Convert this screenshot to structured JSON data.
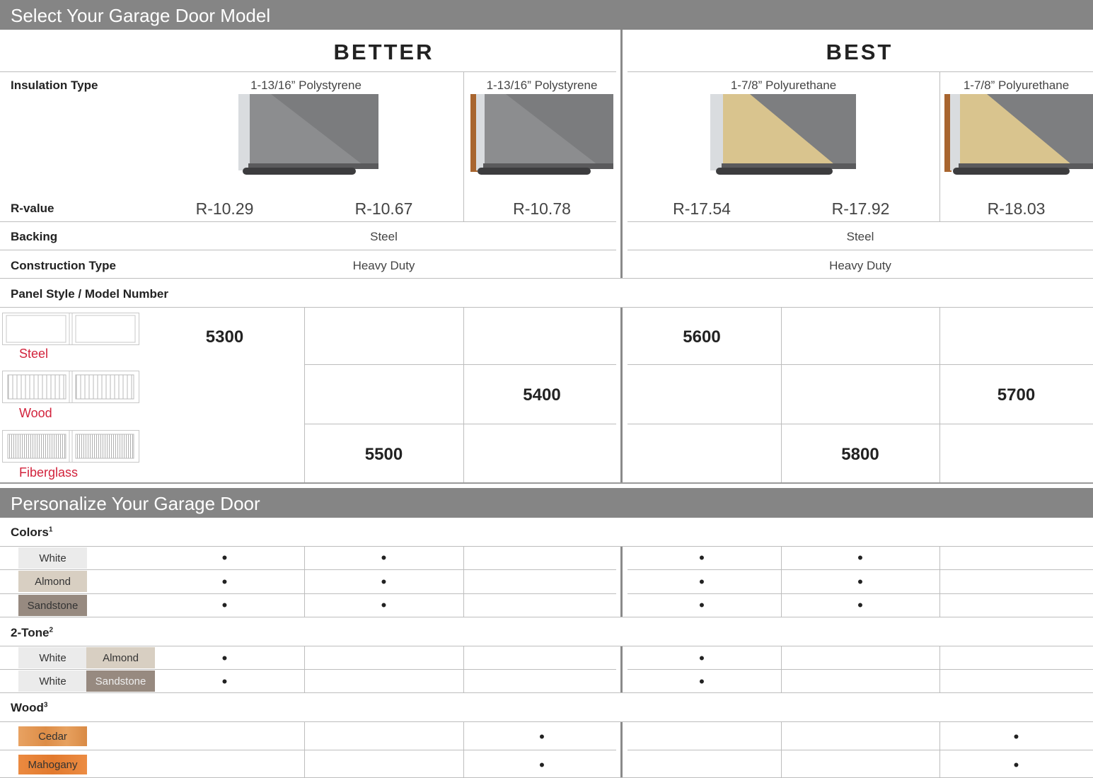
{
  "sections": {
    "select_title": "Select Your Garage Door Model",
    "personalize_title": "Personalize Your Garage Door"
  },
  "tiers": {
    "better": "BETTER",
    "best": "BEST"
  },
  "row_labels": {
    "insulation": "Insulation Type",
    "rvalue": "R-value",
    "backing": "Backing",
    "construction": "Construction Type",
    "panel_style": "Panel Style / Model Number"
  },
  "insulation": {
    "better_a": "1-13/16” Polystyrene",
    "better_b": "1-13/16” Polystyrene",
    "best_a": "1-7/8” Polyurethane",
    "best_b": "1-7/8” Polyurethane"
  },
  "rvalues": [
    "R-10.29",
    "R-10.67",
    "R-10.78",
    "R-17.54",
    "R-17.92",
    "R-18.03"
  ],
  "backing": {
    "better": "Steel",
    "best": "Steel"
  },
  "construction": {
    "better": "Heavy Duty",
    "best": "Heavy Duty"
  },
  "panels": [
    {
      "material": "Steel",
      "models": [
        "5300",
        "",
        "",
        "5600",
        "",
        ""
      ]
    },
    {
      "material": "Wood",
      "models": [
        "",
        "",
        "5400",
        "",
        "",
        "5700"
      ]
    },
    {
      "material": "Fiberglass",
      "models": [
        "",
        "5500",
        "",
        "",
        "5800",
        ""
      ]
    }
  ],
  "colors": {
    "heading": "Colors",
    "footnote": "1",
    "rows": [
      {
        "name": "White",
        "swatch": "#ebebeb",
        "marks": [
          "•",
          "•",
          "",
          "•",
          "•",
          ""
        ]
      },
      {
        "name": "Almond",
        "swatch": "#d8cfc2",
        "marks": [
          "•",
          "•",
          "",
          "•",
          "•",
          ""
        ]
      },
      {
        "name": "Sandstone",
        "swatch": "#978a80",
        "marks": [
          "•",
          "•",
          "",
          "•",
          "•",
          ""
        ]
      }
    ]
  },
  "two_tone": {
    "heading": "2-Tone",
    "footnote": "2",
    "rows": [
      {
        "a": "White",
        "b": "Almond",
        "a_swatch": "#ebebeb",
        "b_swatch": "#d8cfc2",
        "marks": [
          "•",
          "",
          "",
          "•",
          "",
          ""
        ]
      },
      {
        "a": "White",
        "b": "Sandstone",
        "a_swatch": "#ebebeb",
        "b_swatch": "#978a80",
        "marks": [
          "•",
          "",
          "",
          "•",
          "",
          ""
        ]
      }
    ]
  },
  "wood": {
    "heading": "Wood",
    "footnote": "3",
    "rows": [
      {
        "name": "Cedar",
        "swatch": "#e69a55",
        "marks": [
          "",
          "",
          "•",
          "",
          "",
          "•"
        ]
      },
      {
        "name": "Mahogany",
        "swatch": "#e8813a",
        "marks": [
          "",
          "",
          "•",
          "",
          "",
          "•"
        ]
      }
    ]
  },
  "colors_theme": {
    "header_bar": "#858585",
    "material_label": "#d2233c"
  }
}
